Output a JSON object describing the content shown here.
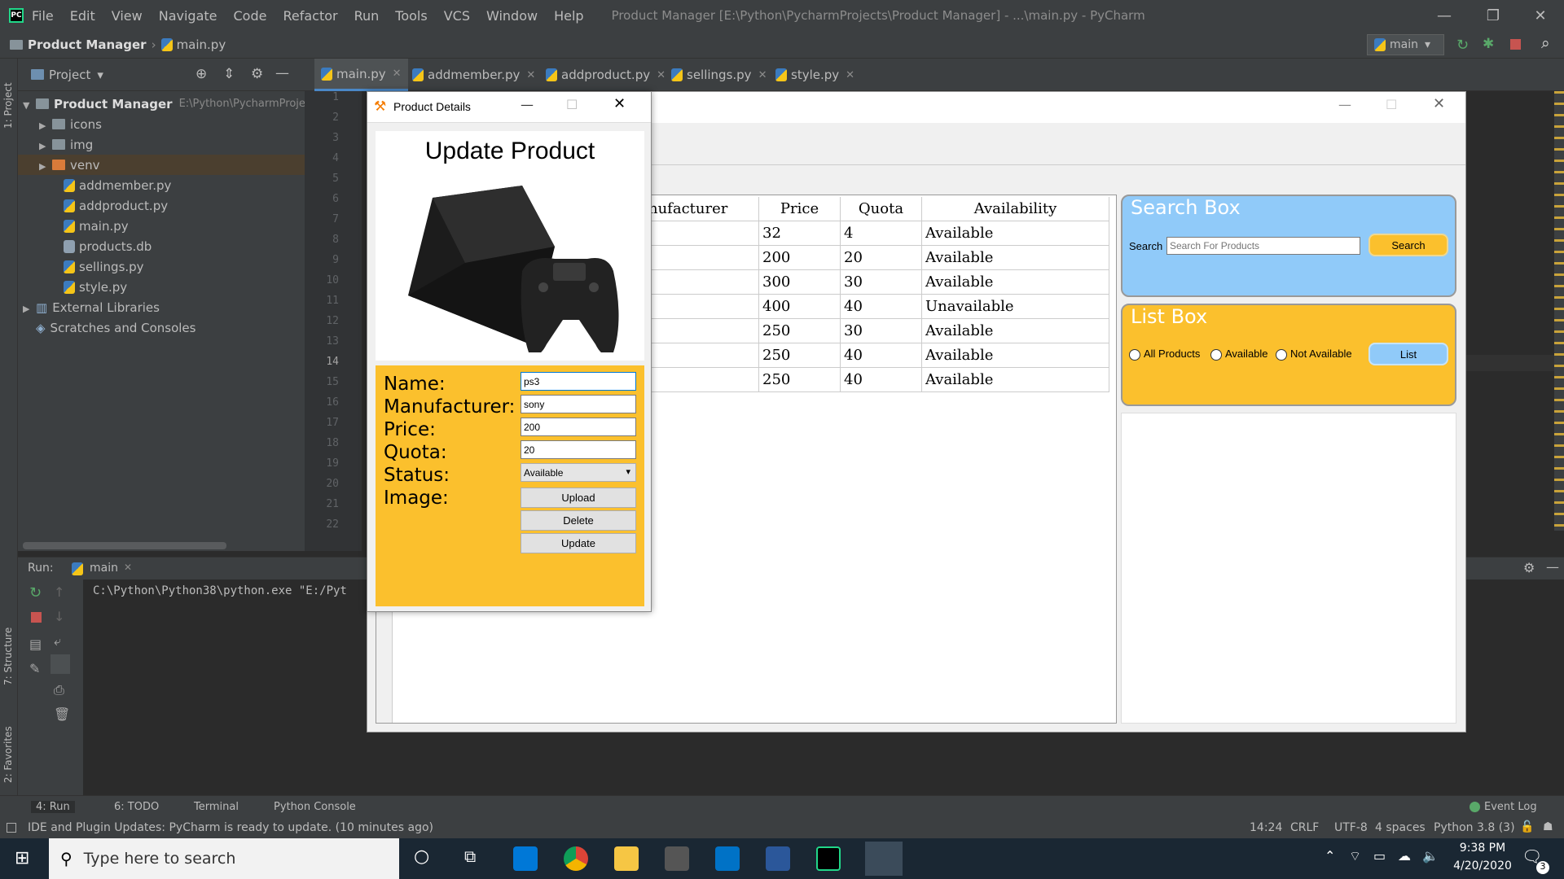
{
  "ide": {
    "menu": [
      "File",
      "Edit",
      "View",
      "Navigate",
      "Code",
      "Refactor",
      "Run",
      "Tools",
      "VCS",
      "Window",
      "Help"
    ],
    "window_title": "Product Manager [E:\\Python\\PycharmProjects\\Product Manager] - ...\\main.py - PyCharm",
    "breadcrumb": {
      "project": "Product Manager",
      "file": "main.py"
    },
    "run_config": "main",
    "project_label": "Project",
    "stripe_project": "1: Project",
    "stripe_structure": "7: Structure",
    "stripe_favorites": "2: Favorites",
    "tree": {
      "root": "Product Manager",
      "root_path": "E:\\Python\\PycharmProject",
      "folders": [
        "icons",
        "img",
        "venv"
      ],
      "files": [
        "addmember.py",
        "addproduct.py",
        "main.py",
        "products.db",
        "sellings.py",
        "style.py"
      ],
      "external": "External Libraries",
      "scratches": "Scratches and Consoles"
    },
    "tabs": [
      "main.py",
      "addmember.py",
      "addproduct.py",
      "sellings.py",
      "style.py"
    ],
    "line_numbers": [
      "1",
      "2",
      "3",
      "4",
      "5",
      "6",
      "7",
      "8",
      "9",
      "10",
      "11",
      "12",
      "13",
      "14",
      "15",
      "16",
      "17",
      "18",
      "19",
      "20",
      "21",
      "22"
    ],
    "run": {
      "label": "Run:",
      "tab": "main",
      "console": "C:\\Python\\Python38\\python.exe \"E:/Pyt"
    },
    "bottom_tools": [
      "4: Run",
      "6: TODO",
      "Terminal",
      "Python Console"
    ],
    "event_log": "Event Log",
    "status": {
      "message": "IDE and Plugin Updates: PyCharm is ready to update. (10 minutes ago)",
      "position": "14:24",
      "line_sep": "CRLF",
      "encoding": "UTF-8",
      "indent": "4 spaces",
      "interpreter": "Python 3.8 (3)"
    }
  },
  "app": {
    "table": {
      "headers": [
        "nufacturer",
        "Price",
        "Quota",
        "Availability"
      ],
      "rows": [
        [
          "",
          "32",
          "4",
          "Available"
        ],
        [
          "",
          "200",
          "20",
          "Available"
        ],
        [
          "",
          "300",
          "30",
          "Available"
        ],
        [
          "",
          "400",
          "40",
          "Unavailable"
        ],
        [
          "",
          "250",
          "30",
          "Available"
        ],
        [
          "",
          "250",
          "40",
          "Available"
        ],
        [
          "",
          "250",
          "40",
          "Available"
        ]
      ]
    },
    "search_box": {
      "title": "Search Box",
      "label": "Search",
      "placeholder": "Search For Products",
      "button": "Search"
    },
    "list_box": {
      "title": "List Box",
      "options": [
        "All Products",
        "Available",
        "Not Available"
      ],
      "button": "List"
    }
  },
  "dialog": {
    "title": "Product Details",
    "heading": "Update Product",
    "labels": {
      "name": "Name:",
      "manufacturer": "Manufacturer:",
      "price": "Price:",
      "quota": "Quota:",
      "status": "Status:",
      "image": "Image:"
    },
    "values": {
      "name": "ps3",
      "manufacturer": "sony",
      "price": "200",
      "quota": "20",
      "status": "Available"
    },
    "buttons": {
      "upload": "Upload",
      "delete": "Delete",
      "update": "Update"
    }
  },
  "taskbar": {
    "search_placeholder": "Type here to search",
    "time": "9:38 PM",
    "date": "4/20/2020",
    "notif_count": "3"
  },
  "colors": {
    "ide_bg": "#2b2b2b",
    "panel": "#3c3f41",
    "accent_yellow": "#fbc02d",
    "accent_blue": "#90caf9"
  }
}
